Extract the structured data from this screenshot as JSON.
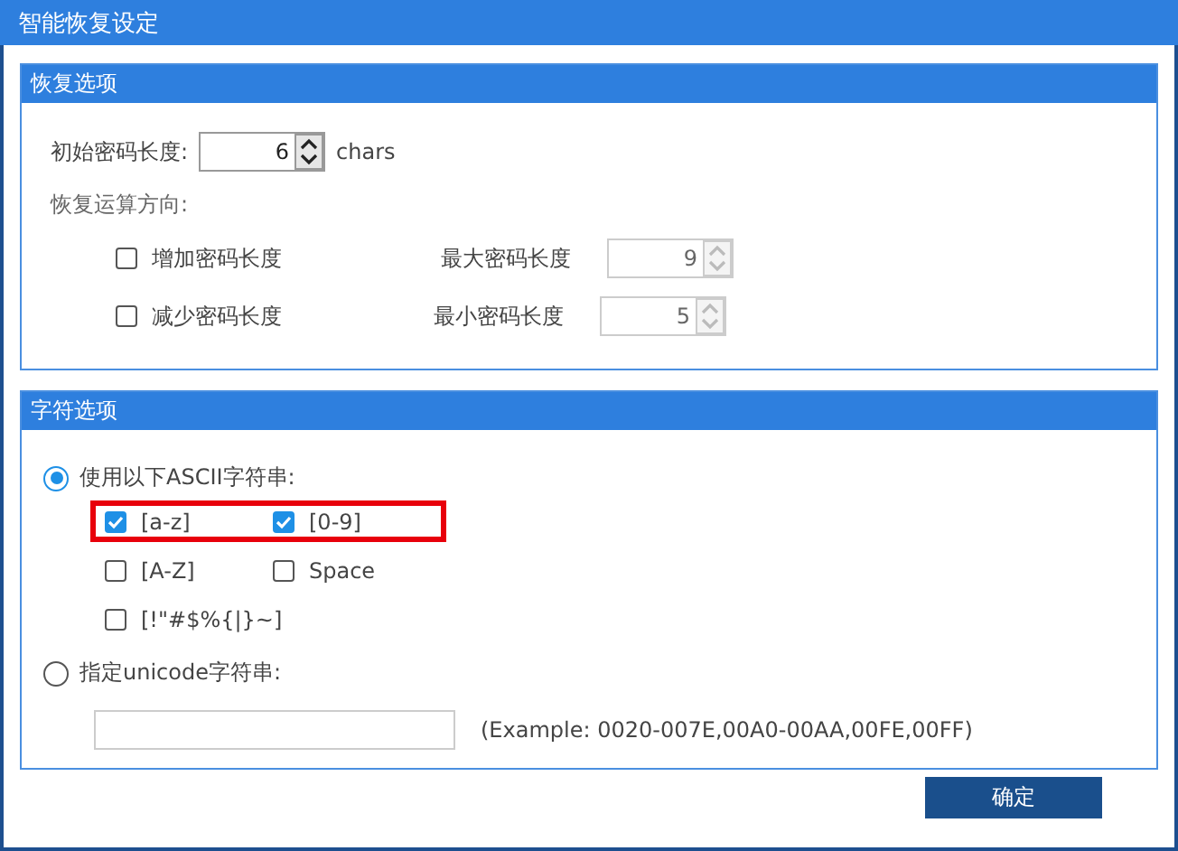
{
  "window": {
    "title": "智能恢复设定"
  },
  "recovery": {
    "title": "恢复选项",
    "initial_length": {
      "label": "初始密码长度:",
      "value": "6",
      "unit": "chars"
    },
    "direction_label": "恢复运算方向:",
    "directions": [
      {
        "label": "增加密码长度",
        "checked": false,
        "limit_label": "最大密码长度",
        "limit_value": "9",
        "disabled": true
      },
      {
        "label": "减少密码长度",
        "checked": false,
        "limit_label": "最小密码长度",
        "limit_value": "5",
        "disabled": true
      }
    ]
  },
  "charset": {
    "title": "字符选项",
    "ascii": {
      "label": "使用以下ASCII字符串:",
      "selected": true,
      "rows": [
        {
          "highlighted": true,
          "items": [
            {
              "label": "[a-z]",
              "checked": true
            },
            {
              "label": "[0-9]",
              "checked": true
            }
          ]
        },
        {
          "highlighted": false,
          "items": [
            {
              "label": "[A-Z]",
              "checked": false
            },
            {
              "label": "Space",
              "checked": false
            }
          ]
        },
        {
          "highlighted": false,
          "items": [
            {
              "label": "[!\"#$%{|}~]",
              "checked": false
            }
          ]
        }
      ]
    },
    "unicode": {
      "label": "指定unicode字符串:",
      "selected": false,
      "hint": "(Example: 0020-007E,00A0-00AA,00FE,00FF)"
    }
  },
  "buttons": [
    "确定"
  ]
}
